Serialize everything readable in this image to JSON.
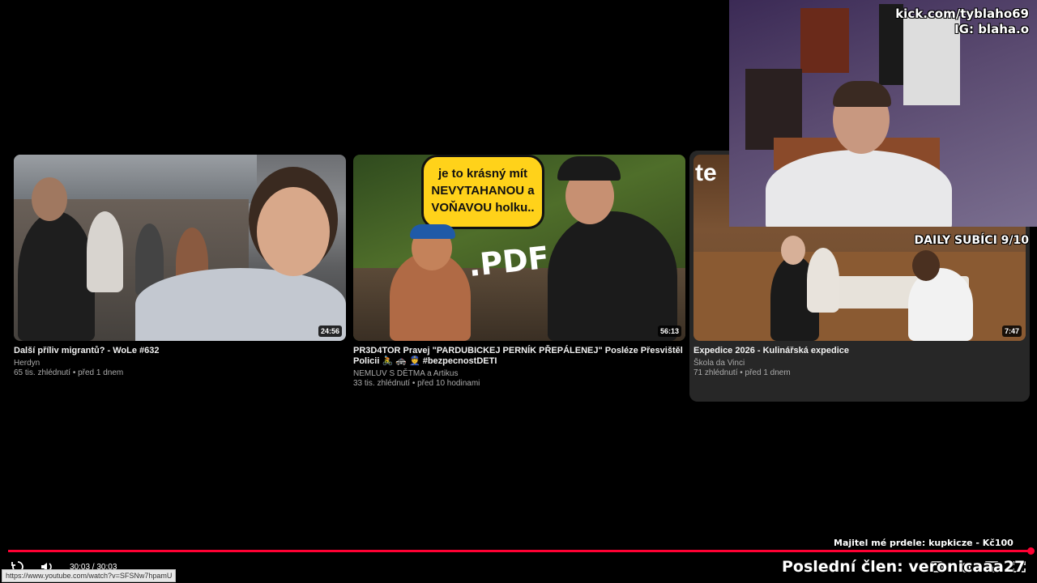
{
  "videos": [
    {
      "title": "Další příliv migrantů? - WoLe #632",
      "channel": "Herdyn",
      "stats": "65 tis. zhlédnutí • před 1 dnem",
      "duration": "24:56"
    },
    {
      "title": "PR3D4TOR Pravej \"PARDUBICKEJ PERNÍK PŘEPÁLENEJ\" Posléze Přesvištěl Policii 🚴 🚓 👮 #bezpecnostDETI",
      "channel": "NEMLUV S DĚTMA a Artikus",
      "stats": "33 tis. zhlédnutí • před 10 hodinami",
      "duration": "56:13",
      "thumb_bubble": "je to krásný mít NEVYTAHANOU a VOŇAVOU holku..",
      "thumb_text": ".PDF"
    },
    {
      "title": "Expedice 2026 - Kulinářská expedice",
      "channel": "Škola da Vinci",
      "stats": "71 zhlédnutí • před 1 dnem",
      "duration": "7:47",
      "thumb_text": "te"
    }
  ],
  "stream_overlay": {
    "kick_handle": "kick.com/tyblaho69",
    "ig_handle": "IG: blaha.o",
    "daily_subs": "DAILY SUBÍCI 9/10",
    "owner_line": "Majitel mé prdele: kupkicze - Kč100",
    "last_member": "Poslední člen: veronicaaa27"
  },
  "player": {
    "time": "30:03 / 30:03",
    "hover_url": "https://www.youtube.com/watch?v=SFSNw7hpamU"
  },
  "colors": {
    "progress": "#ff0033",
    "card_hover": "#272727"
  }
}
